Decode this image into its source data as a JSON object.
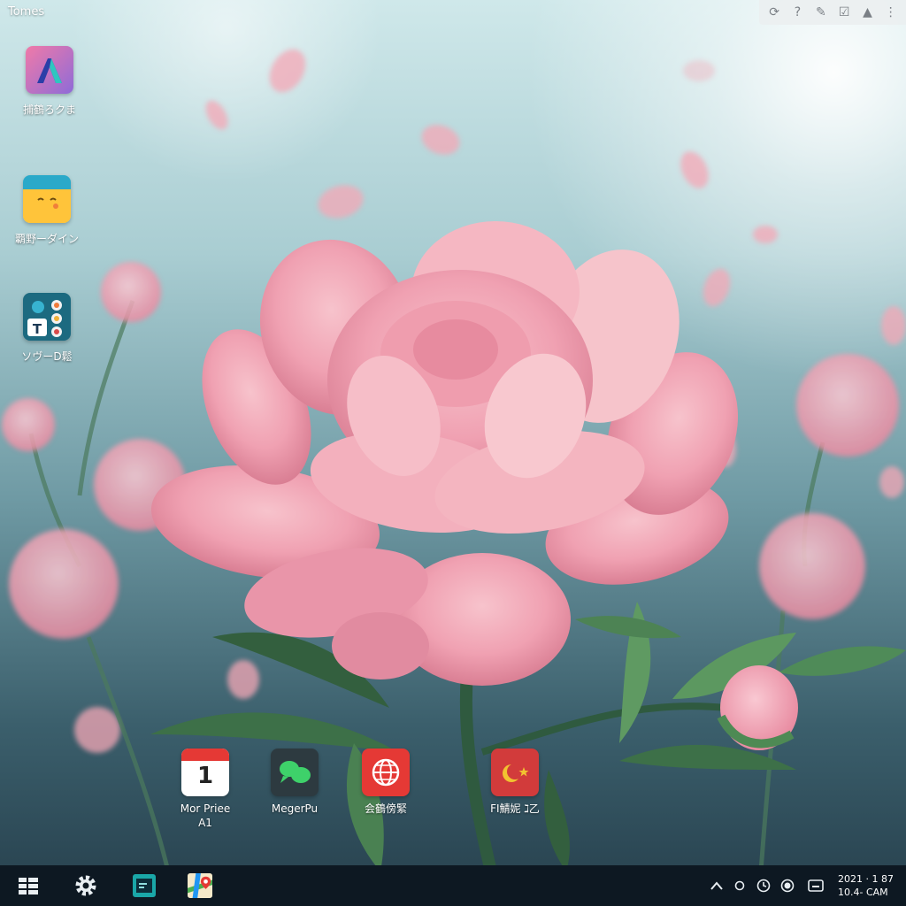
{
  "window": {
    "title": "Tomes"
  },
  "top_tray": {
    "icons": [
      "power-settings-icon",
      "help-icon",
      "pen-icon",
      "checkbox-icon",
      "lock-icon",
      "more-icon"
    ],
    "glyphs": [
      "⟳",
      "?",
      "✎",
      "☑",
      "▲",
      "⋮"
    ]
  },
  "desktop_icons": [
    {
      "label": "捕鶴ろクま"
    },
    {
      "label": "覇野ーダイン"
    },
    {
      "label": "ソヴーD鬆"
    },
    {
      "label": "Mor Priee\nA1",
      "badge": "1"
    },
    {
      "label": "MegerPu"
    },
    {
      "label": "会鶴傍緊"
    },
    {
      "label": "FI鯖妮 ℷ乙"
    }
  ],
  "taskbar": {
    "clock_line1": "2021 · 1 87",
    "clock_line2": "10.4- CAM"
  },
  "colors": {
    "taskbar": "#0d1822",
    "petal": "#f2a3b3",
    "accent_red": "#e53935"
  }
}
